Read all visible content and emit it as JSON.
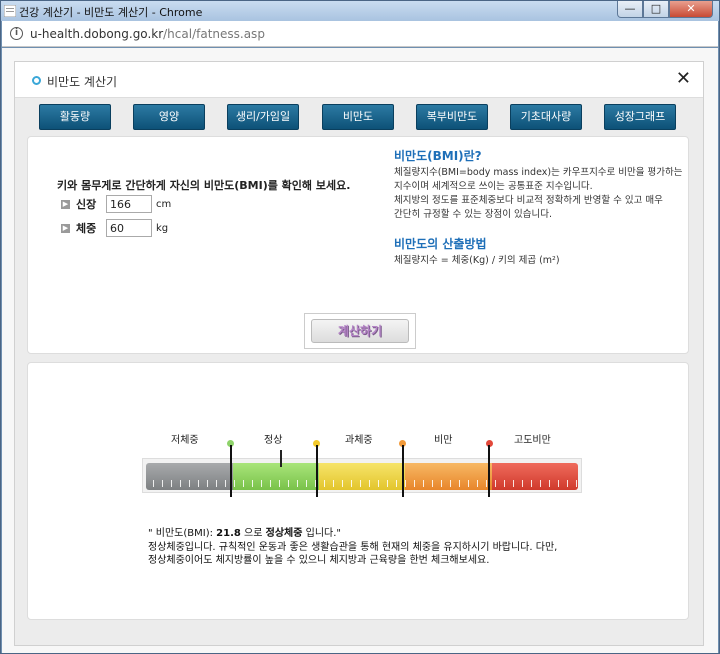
{
  "window": {
    "title": "건강 계산기 - 비만도 계산기 - Chrome",
    "buttons": {
      "minimize": "—",
      "maximize": "□",
      "close": "✕"
    }
  },
  "address": {
    "host": "u-health.dobong.go.kr",
    "path": "/hcal/fatness.asp"
  },
  "header": {
    "title": "비만도 계산기",
    "close": "✕"
  },
  "tabs": [
    "활동량",
    "영양",
    "생리/가임일",
    "비만도",
    "복부비만도",
    "기초대사량",
    "성장그래프"
  ],
  "form": {
    "intro": "키와 몸무게로 간단하게 자신의 비만도(BMI)를 확인해 보세요.",
    "height_label": "신장",
    "height_value": "166",
    "height_unit": "cm",
    "weight_label": "체중",
    "weight_value": "60",
    "weight_unit": "kg",
    "calc_button": "계산하기"
  },
  "info": {
    "h1": "비만도(BMI)란?",
    "p1a": "체질량지수(BMI=body mass index)는 카우프지수로 비만을 평가하는",
    "p1b": "지수이며 세계적으로 쓰이는 공통표준 지수입니다.",
    "p1c": "체지방의 정도를 표준체중보다 비교적 정확하게 반영할 수 있고 매우",
    "p1d": "간단히 규정할 수 있는 장점이 있습니다.",
    "h2": "비만도의 산출방법",
    "formula": "체질량지수 = 체중(Kg) / 키의 제곱 (m²)"
  },
  "gauge": {
    "labels": [
      "저체중",
      "정상",
      "과체중",
      "비만",
      "고도비만"
    ],
    "colors": {
      "under": "#8f9294",
      "normal": "#8fd25a",
      "over": "#ecd33c",
      "obese": "#f09a38",
      "severe": "#e0493c",
      "dot_normal": "#8ed26a",
      "dot_over": "#f2c92c",
      "dot_obese": "#f29a3a",
      "dot_severe": "#e2483a"
    },
    "bmi": 21.8
  },
  "result": {
    "prefix": "\" 비만도(BMI): ",
    "bmi": "21.8",
    "mid": " 으로 ",
    "category": "정상체중",
    "suffix": " 입니다.\"",
    "line2": "정상체중입니다. 규칙적인 운동과 좋은 생활습관을 통해 현재의 체중을 유지하시기 바랍니다. 다만, 정상체중이어도 체지방률이 높을 수 있으니 체지방과 근육량을 한번 체크해보세요."
  }
}
